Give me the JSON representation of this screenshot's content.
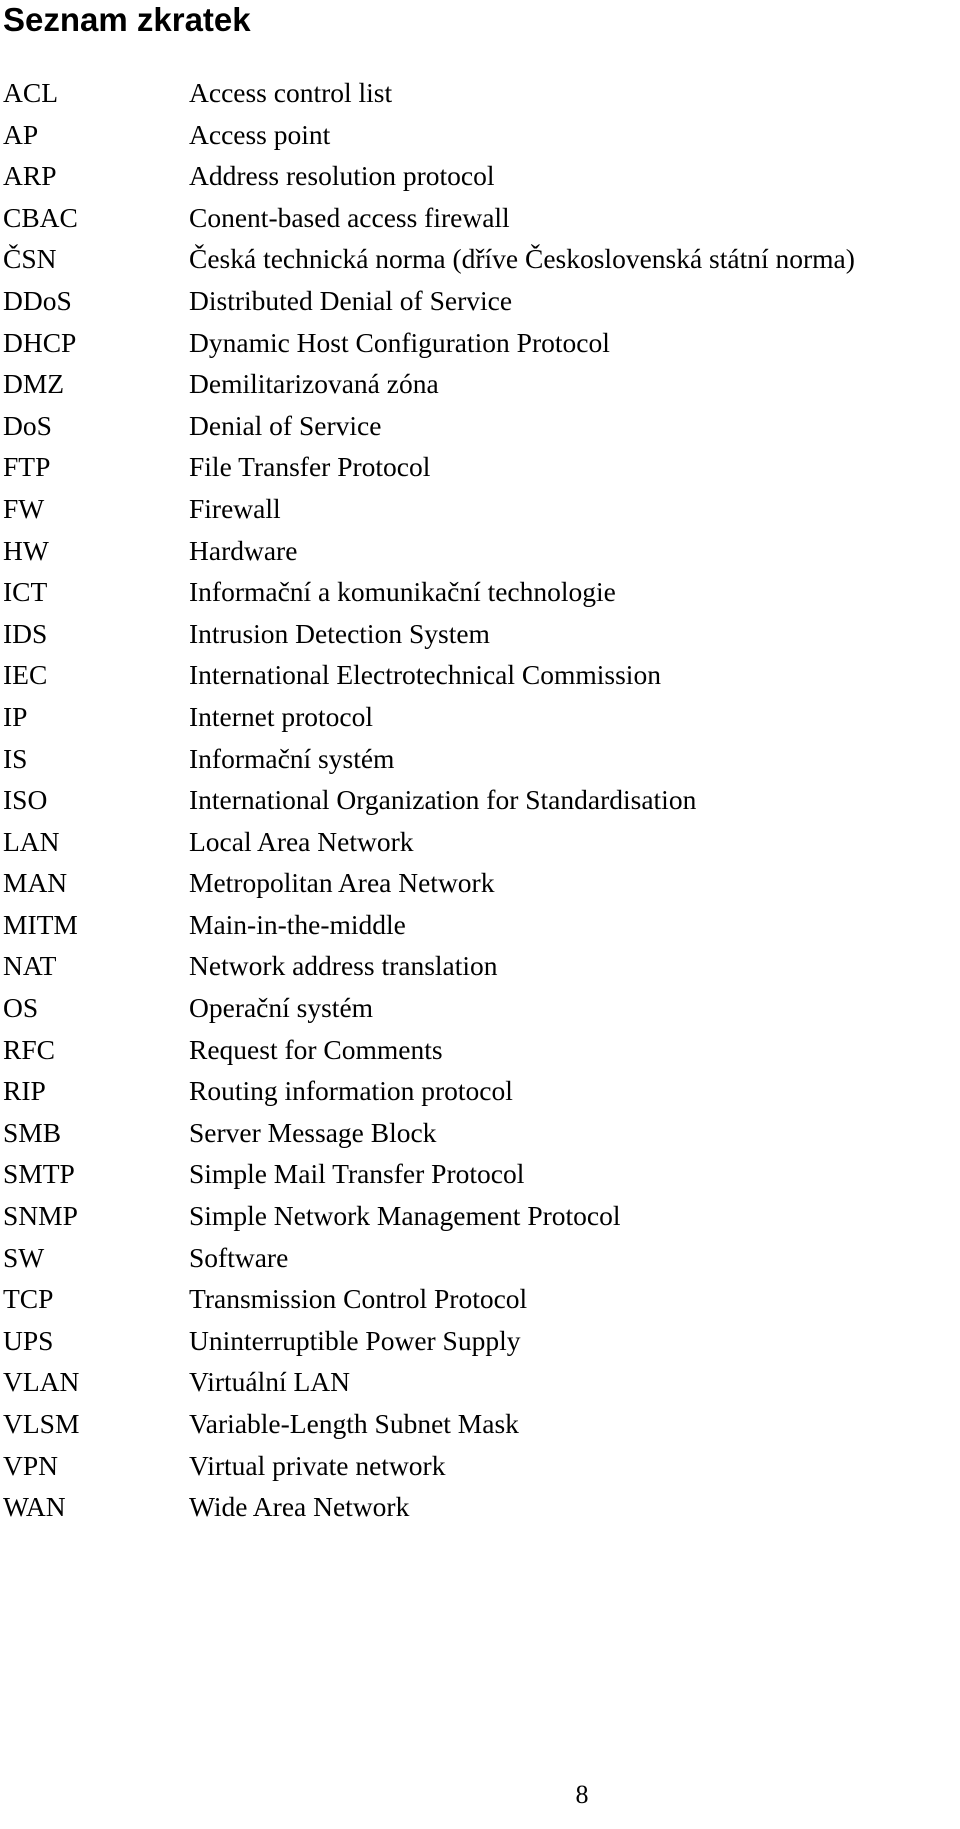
{
  "document": {
    "title": "Seznam zkratek",
    "page_number": "8",
    "abbreviations": [
      {
        "abbr": "ACL",
        "desc": "Access control list"
      },
      {
        "abbr": "AP",
        "desc": "Access point"
      },
      {
        "abbr": "ARP",
        "desc": "Address resolution protocol"
      },
      {
        "abbr": "CBAC",
        "desc": "Conent-based access firewall"
      },
      {
        "abbr": "ČSN",
        "desc": "Česká technická norma (dříve Československá státní norma)"
      },
      {
        "abbr": "DDoS",
        "desc": "Distributed Denial of Service"
      },
      {
        "abbr": "DHCP",
        "desc": "Dynamic Host Configuration Protocol"
      },
      {
        "abbr": "DMZ",
        "desc": "Demilitarizovaná zóna"
      },
      {
        "abbr": "DoS",
        "desc": "Denial of Service"
      },
      {
        "abbr": "FTP",
        "desc": "File Transfer Protocol"
      },
      {
        "abbr": "FW",
        "desc": "Firewall"
      },
      {
        "abbr": "HW",
        "desc": "Hardware"
      },
      {
        "abbr": "ICT",
        "desc": "Informační a komunikační technologie"
      },
      {
        "abbr": "IDS",
        "desc": "Intrusion Detection System"
      },
      {
        "abbr": "IEC",
        "desc": "International Electrotechnical Commission"
      },
      {
        "abbr": "IP",
        "desc": "Internet protocol"
      },
      {
        "abbr": "IS",
        "desc": "Informační systém"
      },
      {
        "abbr": "ISO",
        "desc": "International Organization for Standardisation"
      },
      {
        "abbr": "LAN",
        "desc": "Local Area Network"
      },
      {
        "abbr": "MAN",
        "desc": "Metropolitan Area Network"
      },
      {
        "abbr": "MITM",
        "desc": "Main-in-the-middle"
      },
      {
        "abbr": "NAT",
        "desc": "Network address translation"
      },
      {
        "abbr": "OS",
        "desc": "Operační systém"
      },
      {
        "abbr": "RFC",
        "desc": "Request for Comments"
      },
      {
        "abbr": "RIP",
        "desc": "Routing information protocol"
      },
      {
        "abbr": "SMB",
        "desc": "Server Message Block"
      },
      {
        "abbr": "SMTP",
        "desc": "Simple Mail Transfer Protocol"
      },
      {
        "abbr": "SNMP",
        "desc": "Simple Network Management Protocol"
      },
      {
        "abbr": "SW",
        "desc": "Software"
      },
      {
        "abbr": "TCP",
        "desc": "Transmission Control Protocol"
      },
      {
        "abbr": "UPS",
        "desc": "Uninterruptible Power Supply"
      },
      {
        "abbr": "VLAN",
        "desc": "Virtuální LAN"
      },
      {
        "abbr": "VLSM",
        "desc": "Variable-Length Subnet Mask"
      },
      {
        "abbr": "VPN",
        "desc": "Virtual private network"
      },
      {
        "abbr": "WAN",
        "desc": "Wide Area Network"
      }
    ]
  }
}
